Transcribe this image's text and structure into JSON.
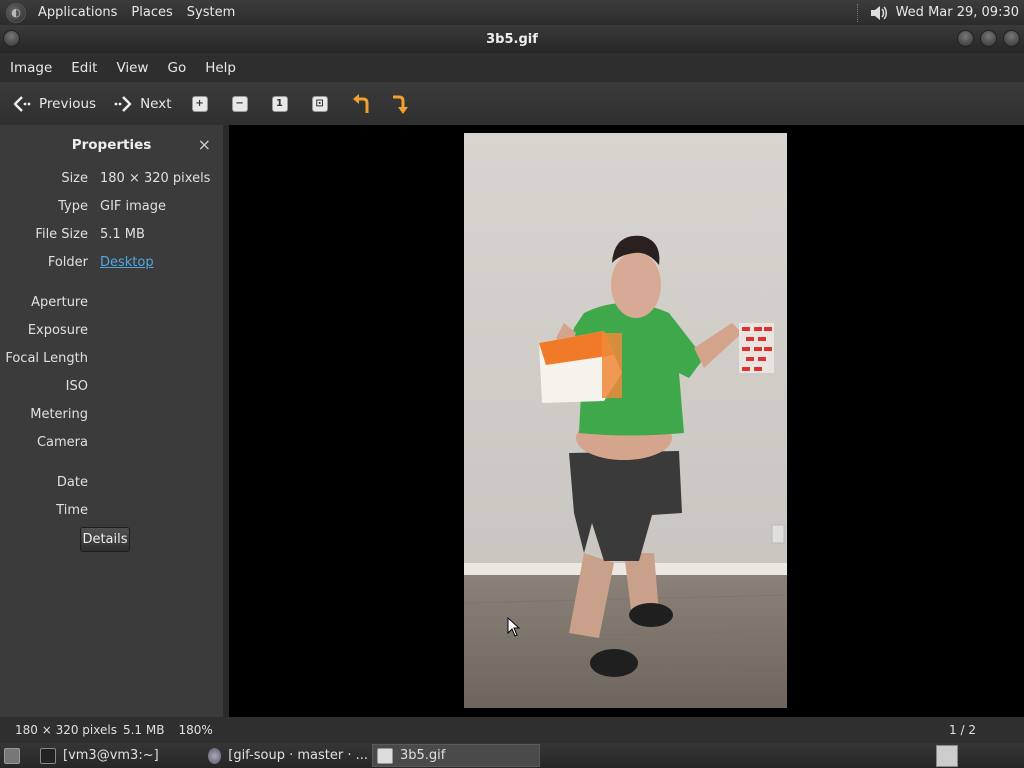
{
  "top_panel": {
    "menu": [
      "Applications",
      "Places",
      "System"
    ],
    "clock": "Wed Mar 29, 09:30"
  },
  "window": {
    "title": "3b5.gif"
  },
  "menubar": [
    "Image",
    "Edit",
    "View",
    "Go",
    "Help"
  ],
  "toolbar": {
    "previous_label": "Previous",
    "next_label": "Next"
  },
  "sidebar": {
    "title": "Properties",
    "close_glyph": "×",
    "rows": [
      {
        "key": "Size",
        "value": "180 × 320 pixels"
      },
      {
        "key": "Type",
        "value": "GIF image"
      },
      {
        "key": "File Size",
        "value": "5.1 MB"
      },
      {
        "key": "Folder",
        "value": "Desktop"
      },
      {
        "key": "Aperture",
        "value": ""
      },
      {
        "key": "Exposure",
        "value": ""
      },
      {
        "key": "Focal Length",
        "value": ""
      },
      {
        "key": "ISO",
        "value": ""
      },
      {
        "key": "Metering",
        "value": ""
      },
      {
        "key": "Camera",
        "value": ""
      },
      {
        "key": "Date",
        "value": ""
      },
      {
        "key": "Time",
        "value": ""
      }
    ],
    "details_label": "Details"
  },
  "statusbar": {
    "dimensions": "180 × 320 pixels",
    "filesize": "5.1 MB",
    "zoom": "180%",
    "page": "1 / 2"
  },
  "taskbar": {
    "tasks": [
      "[vm3@vm3:~]",
      "[gif-soup · master · ...",
      "3b5.gif"
    ]
  },
  "colors": {
    "link": "#4fa8e0",
    "toolbar_arrow": "#f0a030"
  }
}
